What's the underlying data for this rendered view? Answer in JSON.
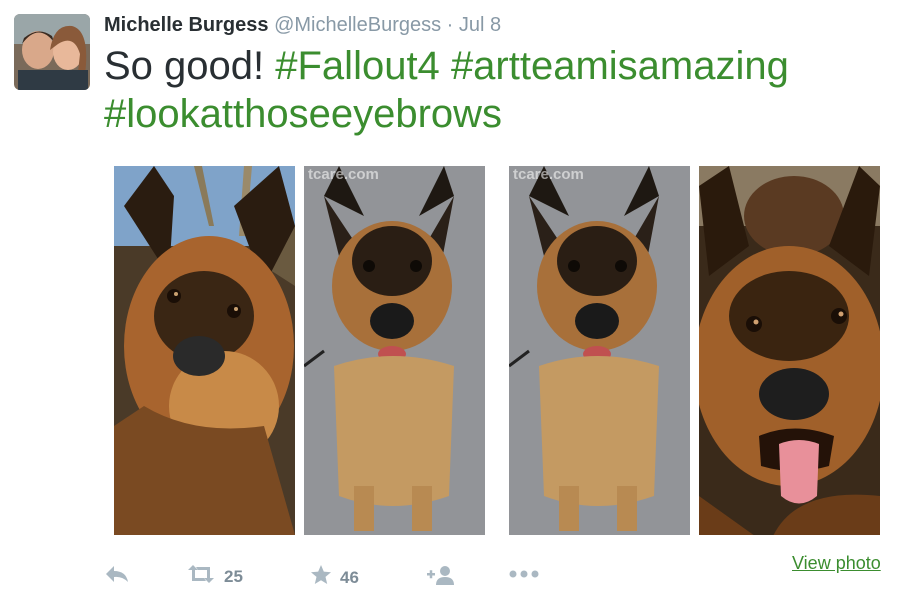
{
  "tweet": {
    "author_name": "Michelle Burgess",
    "handle": "@MichelleBurgess",
    "separator": "·",
    "date": "Jul 8",
    "text_plain": "So good! ",
    "hashtags": [
      "#Fallout4",
      "#artteamisamazing",
      "#lookatthoseeyebrows"
    ]
  },
  "media": {
    "photos": [
      {
        "subject": "game-render-dog",
        "watermark": ""
      },
      {
        "subject": "real-dog-photo",
        "watermark": "tcare.com"
      },
      {
        "subject": "real-dog-photo",
        "watermark": "tcare.com"
      },
      {
        "subject": "game-render-dog-tongue-out",
        "watermark": ""
      }
    ],
    "view_photo_label": "View photo"
  },
  "actions": {
    "reply_icon": "reply-icon",
    "retweet_icon": "retweet-icon",
    "retweet_count": "25",
    "favorite_icon": "star-icon",
    "favorite_count": "46",
    "follow_icon": "follow-icon",
    "more_icon": "more-icon"
  },
  "colors": {
    "hashtag": "#3b8d2f",
    "name": "#292f33",
    "meta": "#8899a6",
    "action_icon": "#aab8c2"
  }
}
